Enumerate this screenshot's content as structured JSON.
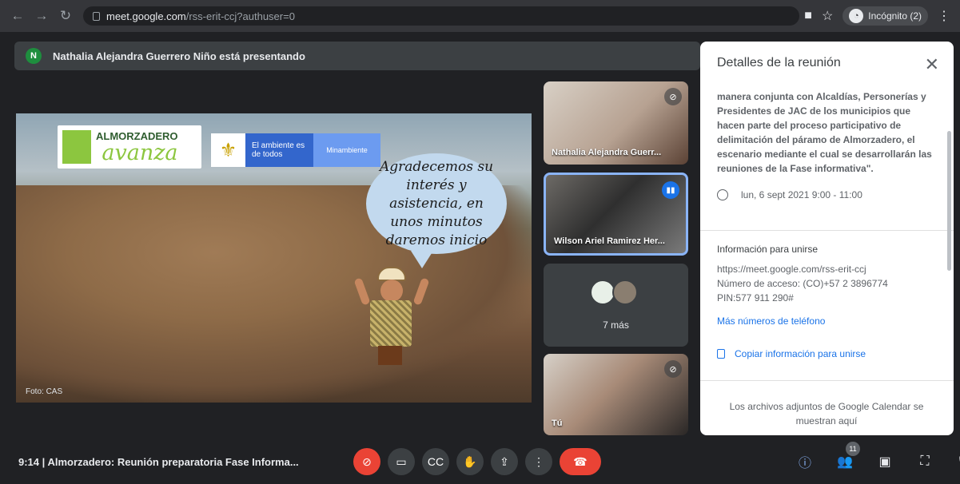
{
  "browser": {
    "url_host": "meet.google.com",
    "url_path": "/rss-erit-ccj?authuser=0",
    "incognito_label": "Incógnito (2)"
  },
  "banner": {
    "avatar_initial": "N",
    "text": "Nathalia Alejandra Guerrero Niño está presentando"
  },
  "slide": {
    "logo_top": "ALMORZADERO",
    "logo_bottom": "avanza",
    "gov_text": "El ambiente es de todos",
    "gov_min": "Minambiente",
    "speech": "Agradecemos su interés y asistencia, en unos minutos daremos inicio",
    "credit": "Foto: CAS"
  },
  "participants": {
    "tile1_name": "Nathalia Alejandra Guerr...",
    "tile2_name": "Wilson Ariel Ramirez Her...",
    "more_text": "7 más",
    "tile4_name": "Tú"
  },
  "panel": {
    "title": "Detalles de la reunión",
    "description": "manera conjunta con Alcaldías, Personerías y Presidentes de JAC de los municipios que hacen parte del proceso participativo de delimitación del páramo de Almorzadero, el escenario mediante el cual se desarrollarán las reuniones de la Fase informativa\".",
    "date": "lun, 6 sept 2021 9:00 - 11:00",
    "join_title": "Información para unirse",
    "join_url": "https://meet.google.com/rss-erit-ccj",
    "access_number": "Número de acceso: (CO)+57 2 3896774",
    "pin": "PIN:577 911 290#",
    "more_phone": "Más números de teléfono",
    "copy_label": "Copiar información para unirse",
    "attachments": "Los archivos adjuntos de Google Calendar se muestran aquí"
  },
  "bottom": {
    "time": "9:14",
    "meeting_name": "Almorzadero: Reunión preparatoria Fase Informa...",
    "participants_count": "11"
  },
  "colors": {
    "accent": "#1a73e8",
    "danger": "#ea4335",
    "surface": "#202124"
  }
}
